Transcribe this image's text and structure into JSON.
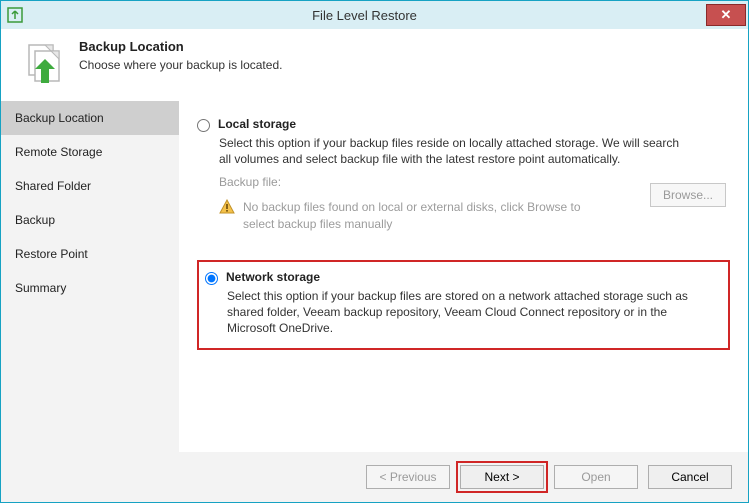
{
  "titlebar": {
    "title": "File Level Restore"
  },
  "header": {
    "title": "Backup Location",
    "subtitle": "Choose where your backup is located."
  },
  "sidebar": {
    "items": [
      {
        "label": "Backup Location"
      },
      {
        "label": "Remote Storage"
      },
      {
        "label": "Shared Folder"
      },
      {
        "label": "Backup"
      },
      {
        "label": "Restore Point"
      },
      {
        "label": "Summary"
      }
    ]
  },
  "content": {
    "local": {
      "label": "Local storage",
      "desc": "Select this option if your backup files reside on locally attached storage. We will search all volumes and select backup file with the latest restore point automatically.",
      "backup_file_label": "Backup file:",
      "warn": "No backup files found on local or external disks, click Browse to select backup files manually",
      "browse": "Browse..."
    },
    "network": {
      "label": "Network storage",
      "desc": "Select this option if your backup files are stored on a network attached storage such as shared folder, Veeam backup repository, Veeam Cloud Connect repository or in the Microsoft OneDrive."
    }
  },
  "footer": {
    "previous": "< Previous",
    "next": "Next >",
    "open": "Open",
    "cancel": "Cancel"
  }
}
